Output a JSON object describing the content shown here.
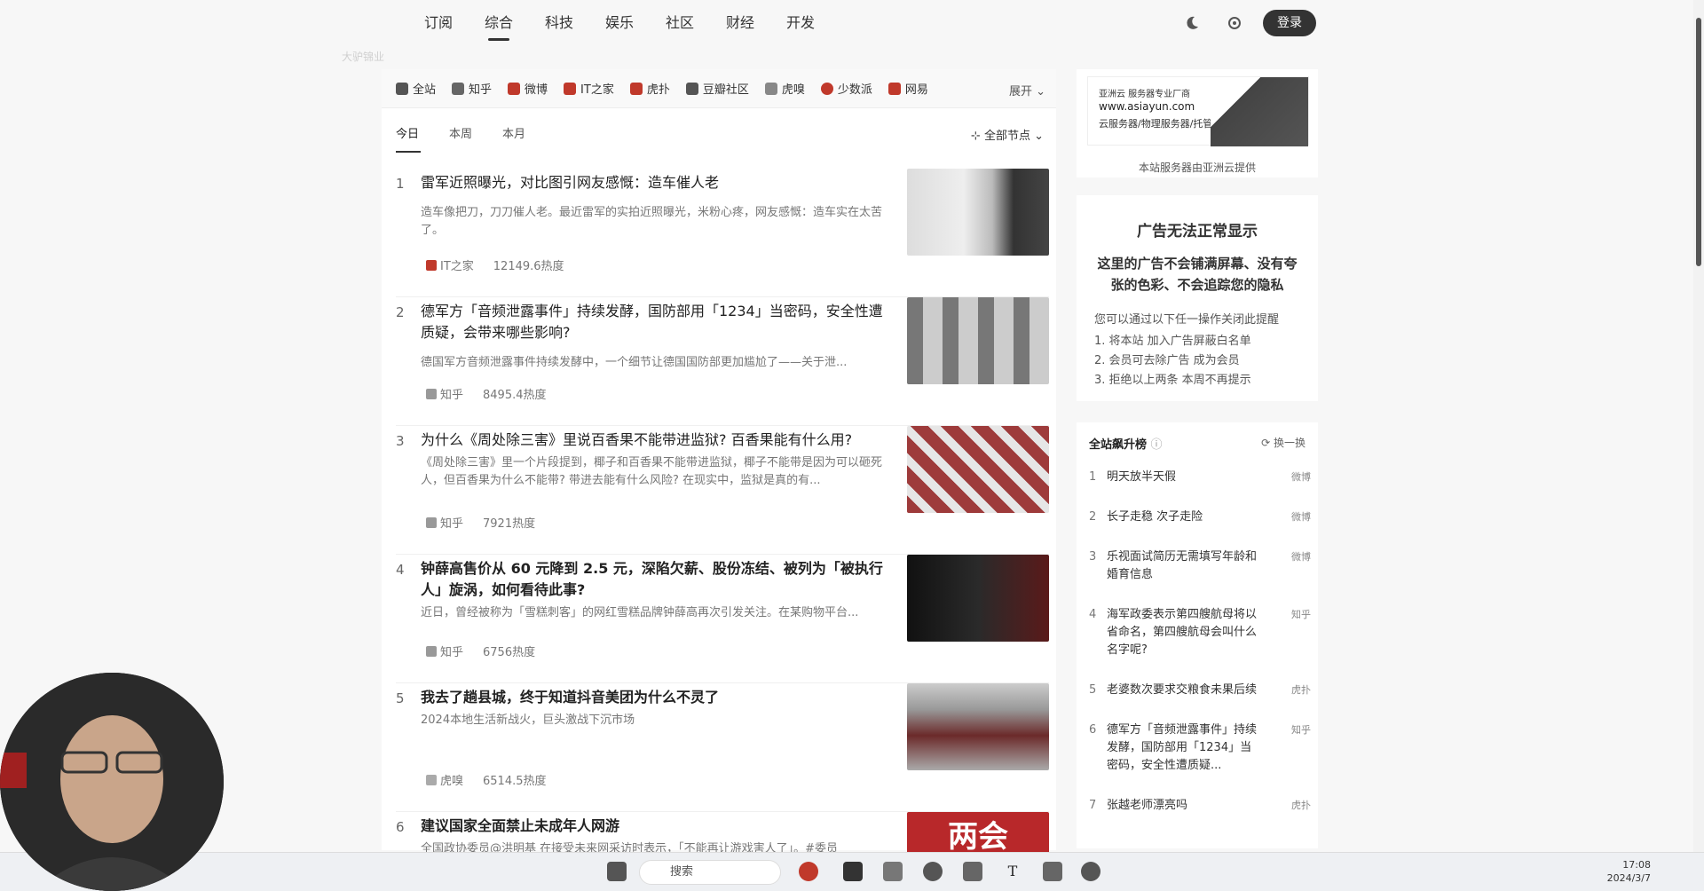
{
  "nav": {
    "tabs": [
      "订阅",
      "综合",
      "科技",
      "娱乐",
      "社区",
      "财经",
      "开发"
    ],
    "active_index": 1,
    "login_label": "登录",
    "watermark_text": "大驴锦业"
  },
  "sources": {
    "items": [
      {
        "label": "全站",
        "color": "#555555"
      },
      {
        "label": "知乎",
        "color": "#666666"
      },
      {
        "label": "微博",
        "color": "#c0392b"
      },
      {
        "label": "IT之家",
        "color": "#c0392b"
      },
      {
        "label": "虎扑",
        "color": "#c0392b"
      },
      {
        "label": "豆瓣社区",
        "color": "#555555"
      },
      {
        "label": "虎嗅",
        "color": "#888888"
      },
      {
        "label": "少数派",
        "color": "#c0392b"
      },
      {
        "label": "网易",
        "color": "#c0392b"
      }
    ],
    "expand_label": "展开"
  },
  "periods": {
    "items": [
      "今日",
      "本周",
      "本月"
    ],
    "active_index": 0,
    "node_filter": "全部节点"
  },
  "list": [
    {
      "rank": "1",
      "title": "雷军近照曝光，对比图引网友感慨：造车催人老",
      "desc": "造车像把刀，刀刀催人老。最近雷军的实拍近照曝光，米粉心疼，网友感慨：造车实在太苦了。",
      "source": "IT之家",
      "heat": "12149.6热度",
      "bold": false
    },
    {
      "rank": "2",
      "title": "德军方「音频泄露事件」持续发酵，国防部用「1234」当密码，安全性遭质疑，会带来哪些影响?",
      "desc": "德国军方音频泄露事件持续发酵中，一个细节让德国国防部更加尴尬了——关于泄...",
      "source": "知乎",
      "heat": "8495.4热度",
      "bold": false
    },
    {
      "rank": "3",
      "title": "为什么《周处除三害》里说百香果不能带进监狱? 百香果能有什么用?",
      "desc": "《周处除三害》里一个片段提到，椰子和百香果不能带进监狱，椰子不能带是因为可以砸死人，但百香果为什么不能带? 带进去能有什么风险? 在现实中，监狱是真的有...",
      "source": "知乎",
      "heat": "7921热度",
      "bold": false
    },
    {
      "rank": "4",
      "title": "钟薛高售价从 60 元降到 2.5 元，深陷欠薪、股份冻结、被列为「被执行人」旋涡，如何看待此事?",
      "desc": "近日，曾经被称为「雪糕刺客」的网红雪糕品牌钟薛高再次引发关注。在某购物平台...",
      "source": "知乎",
      "heat": "6756热度",
      "bold": true
    },
    {
      "rank": "5",
      "title": "我去了趟县城，终于知道抖音美团为什么不灵了",
      "desc": "2024本地生活新战火，巨头激战下沉市场",
      "source": "虎嗅",
      "heat": "6514.5热度",
      "bold": true
    },
    {
      "rank": "6",
      "title": "建议国家全面禁止未成年人网游",
      "desc": "全国政协委员@洪明基 在接受未来网采访时表示，「不能再让游戏害人了」。#委员",
      "source": "",
      "heat": "",
      "bold": true
    }
  ],
  "thumb6_text": "两会",
  "ad1": {
    "line1": "亚洲云 服务器专业厂商",
    "line2": "www.asiayun.com",
    "line3": "云服务器/物理服务器/托管",
    "caption": "本站服务器由亚洲云提供"
  },
  "ad2": {
    "heading": "广告无法正常显示",
    "promise": "这里的广告不会铺满屏幕、没有夸张的色彩、不会追踪您的隐私",
    "intro": "您可以通过以下任一操作关闭此提醒",
    "options": [
      "1. 将本站 加入广告屏蔽白名单",
      "2. 会员可去除广告 成为会员",
      "3. 拒绝以上两条 本周不再提示"
    ]
  },
  "ranking": {
    "title": "全站飙升榜",
    "switch_label": "换一换",
    "items": [
      {
        "n": "1",
        "t": "明天放半天假",
        "s": "微博"
      },
      {
        "n": "2",
        "t": "长子走稳 次子走险",
        "s": "微博"
      },
      {
        "n": "3",
        "t": "乐视面试简历无需填写年龄和婚育信息",
        "s": "微博"
      },
      {
        "n": "4",
        "t": "海军政委表示第四艘航母将以省命名，第四艘航母会叫什么名字呢?",
        "s": "知乎"
      },
      {
        "n": "5",
        "t": "老婆数次要求交粮食未果后续",
        "s": "虎扑"
      },
      {
        "n": "6",
        "t": "德军方「音频泄露事件」持续发酵，国防部用「1234」当密码，安全性遭质疑...",
        "s": "知乎"
      },
      {
        "n": "7",
        "t": "张越老师漂亮吗",
        "s": "虎扑"
      }
    ]
  },
  "taskbar": {
    "search_placeholder": "搜索",
    "time": "17:08",
    "date": "2024/3/7"
  }
}
